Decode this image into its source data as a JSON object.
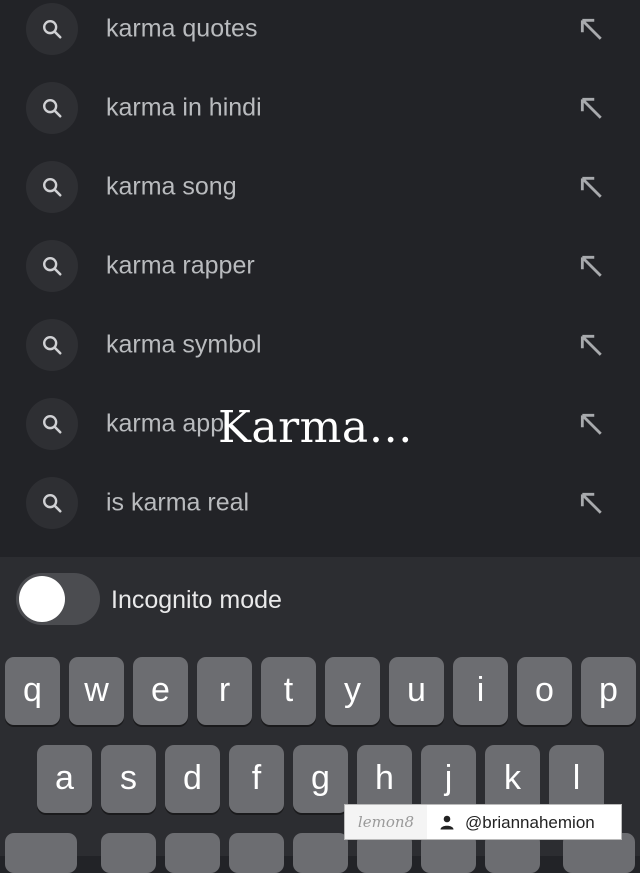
{
  "suggestions": [
    {
      "text": "karma quotes"
    },
    {
      "text": "karma in hindi"
    },
    {
      "text": "karma song"
    },
    {
      "text": "karma rapper"
    },
    {
      "text": "karma symbol"
    },
    {
      "text": "karma app"
    },
    {
      "text": "is karma real"
    }
  ],
  "overlay": {
    "text": "Karma…"
  },
  "incognito": {
    "label": "Incognito mode",
    "enabled": false
  },
  "keyboard": {
    "row1": [
      "q",
      "w",
      "e",
      "r",
      "t",
      "y",
      "u",
      "i",
      "o",
      "p"
    ],
    "row2": [
      "a",
      "s",
      "d",
      "f",
      "g",
      "h",
      "j",
      "k",
      "l"
    ]
  },
  "watermark": {
    "logo": "lemon8",
    "handle": "@briannahemion"
  },
  "icons": {
    "suggestion": "search-icon",
    "fill": "arrow-up-left-icon",
    "watermark_user": "user-icon"
  },
  "colors": {
    "background": "#222327",
    "panel": "#2c2d31",
    "key": "#6c6d71"
  }
}
